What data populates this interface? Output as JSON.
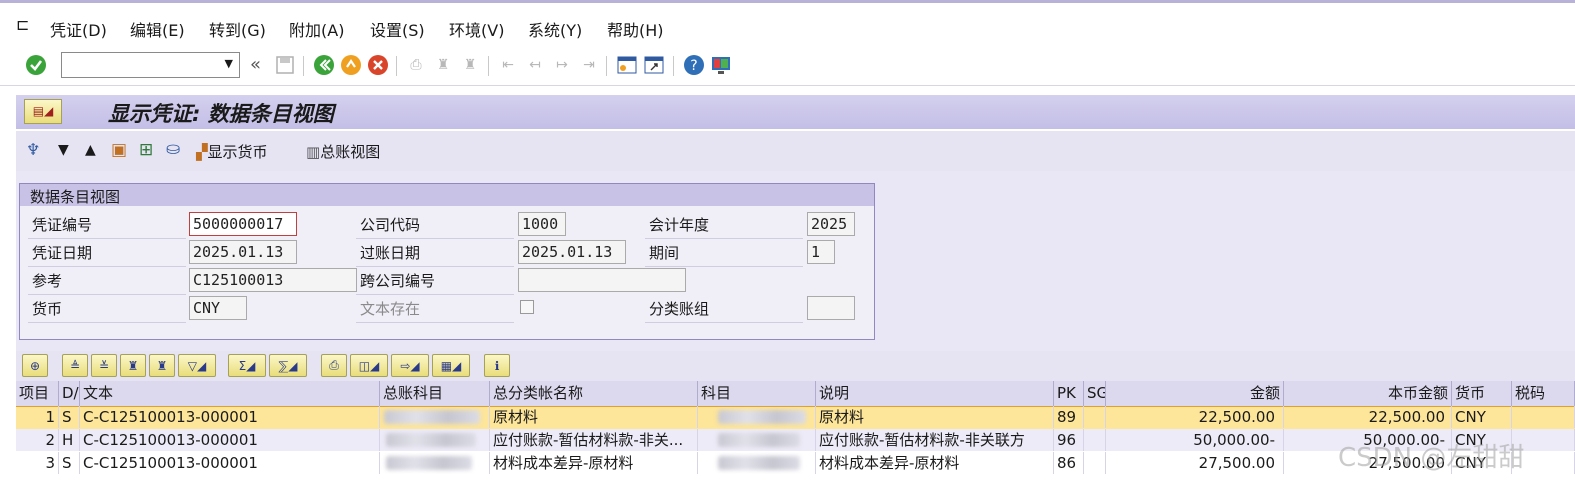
{
  "menu": {
    "items": [
      "凭证(D)",
      "编辑(E)",
      "转到(G)",
      "附加(A)",
      "设置(S)",
      "环境(V)",
      "系统(Y)",
      "帮助(H)"
    ]
  },
  "toolbar": {
    "command_value": "",
    "back_glyph": "«"
  },
  "title": "显示凭证: 数据条目视图",
  "app_toolbar": {
    "display_currency": "显示货币",
    "gl_view": "总账视图"
  },
  "header": {
    "group_title": "数据条目视图",
    "doc_number_label": "凭证编号",
    "doc_number": "5000000017",
    "company_code_label": "公司代码",
    "company_code": "1000",
    "fiscal_year_label": "会计年度",
    "fiscal_year": "2025",
    "doc_date_label": "凭证日期",
    "doc_date": "2025.01.13",
    "posting_date_label": "过账日期",
    "posting_date": "2025.01.13",
    "period_label": "期间",
    "period": "1",
    "reference_label": "参考",
    "reference": "C125100013",
    "cross_company_label": "跨公司编号",
    "cross_company": "",
    "currency_label": "货币",
    "currency": "CNY",
    "text_exists_label": "文本存在",
    "ledger_group_label": "分类账组",
    "ledger_group": ""
  },
  "table": {
    "columns": [
      "项目",
      "D/",
      "文本",
      "总账科目",
      "总分类帐名称",
      "科目",
      "说明",
      "PK",
      "SG",
      "金额",
      "本币金额",
      "货币",
      "税码"
    ],
    "rows": [
      {
        "item": "1",
        "dc": "S",
        "text": "C-C125100013-000001",
        "gl_name": "原材料",
        "desc": "原材料",
        "pk": "89",
        "amount": "22,500.00",
        "local_amount": "22,500.00",
        "currency": "CNY"
      },
      {
        "item": "2",
        "dc": "H",
        "text": "C-C125100013-000001",
        "gl_name": "应付账款-暂估材料款-非关...",
        "desc": "应付账款-暂估材料款-非关联方",
        "pk": "96",
        "amount": "50,000.00-",
        "local_amount": "50,000.00-",
        "currency": "CNY"
      },
      {
        "item": "3",
        "dc": "S",
        "text": "C-C125100013-000001",
        "gl_name": "材料成本差异-原材料",
        "desc": "材料成本差异-原材料",
        "pk": "86",
        "amount": "27,500.00",
        "local_amount": "27,500.00",
        "currency": "CNY"
      }
    ]
  },
  "watermark": "CSDN @左甜甜",
  "colors": {
    "selected_row": "#fde59a",
    "row_alt": "#edebf7",
    "title_bar": "#c9c4e8",
    "ok_green": "#3aa33a"
  }
}
